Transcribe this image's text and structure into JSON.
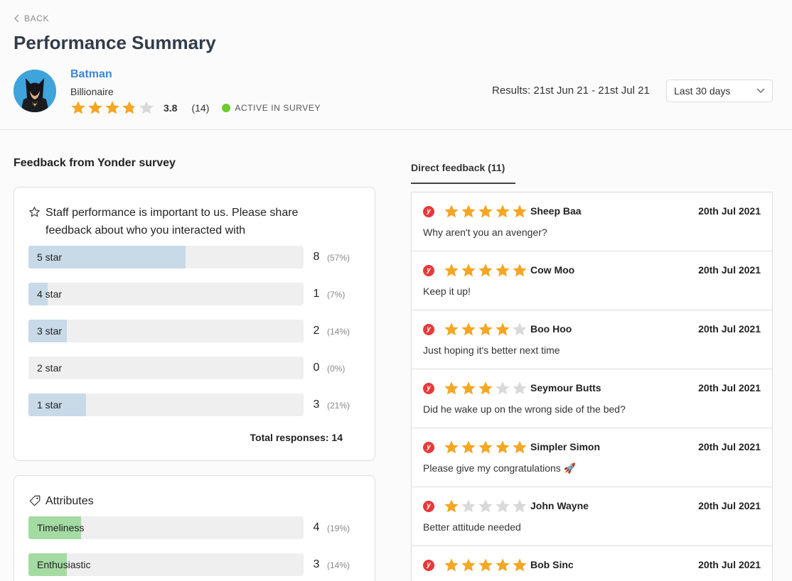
{
  "header": {
    "back_label": "BACK",
    "title": "Performance Summary"
  },
  "profile": {
    "name": "Batman",
    "role": "Billionaire",
    "rating": 3.8,
    "rating_display": "3.8",
    "review_count": "(14)",
    "status": "ACTIVE IN SURVEY",
    "status_color": "#6bcc2e"
  },
  "results": {
    "label": "Results: 21st Jun 21 - 21st Jul 21",
    "period_selected": "Last 30 days"
  },
  "survey": {
    "section_title": "Feedback from Yonder survey",
    "question": "Staff performance is important to us. Please share feedback about who you interacted with",
    "question_icon": "star-outline-icon",
    "distribution": [
      {
        "label": "5 star",
        "count": "8",
        "pct": "(57%)",
        "fraction": 0.57
      },
      {
        "label": "4 star",
        "count": "1",
        "pct": "(7%)",
        "fraction": 0.07
      },
      {
        "label": "3 star",
        "count": "2",
        "pct": "(14%)",
        "fraction": 0.14
      },
      {
        "label": "2 star",
        "count": "0",
        "pct": "(0%)",
        "fraction": 0.0
      },
      {
        "label": "1 star",
        "count": "3",
        "pct": "(21%)",
        "fraction": 0.21
      }
    ],
    "total": "Total responses: 14",
    "bar_color": "#c8d9e8"
  },
  "attributes": {
    "title": "Attributes",
    "icon": "tag-icon",
    "items": [
      {
        "label": "Timeliness",
        "count": "4",
        "pct": "(19%)",
        "fraction": 0.19
      },
      {
        "label": "Enthusiastic",
        "count": "3",
        "pct": "(14%)",
        "fraction": 0.14
      }
    ],
    "bar_color": "#a3dba3"
  },
  "direct_feedback": {
    "tab_label": "Direct feedback (11)",
    "source_icon": "yonder-logo-icon",
    "source_letter": "y",
    "star_color": "#f5a623",
    "items": [
      {
        "name": "Sheep Baa",
        "date": "20th Jul 2021",
        "rating": 5,
        "text": "Why aren't you an avenger?"
      },
      {
        "name": "Cow Moo",
        "date": "20th Jul 2021",
        "rating": 5,
        "text": "Keep it up!"
      },
      {
        "name": "Boo Hoo",
        "date": "20th Jul 2021",
        "rating": 4,
        "text": "Just hoping it's better next time"
      },
      {
        "name": "Seymour Butts",
        "date": "20th Jul 2021",
        "rating": 3,
        "text": "Did he wake up on the wrong side of the bed?"
      },
      {
        "name": "Simpler Simon",
        "date": "20th Jul 2021",
        "rating": 5,
        "text": "Please give my congratulations 🚀"
      },
      {
        "name": "John Wayne",
        "date": "20th Jul 2021",
        "rating": 1,
        "text": "Better attitude needed"
      },
      {
        "name": "Bob Sinc",
        "date": "20th Jul 2021",
        "rating": 5,
        "text": ""
      }
    ]
  }
}
